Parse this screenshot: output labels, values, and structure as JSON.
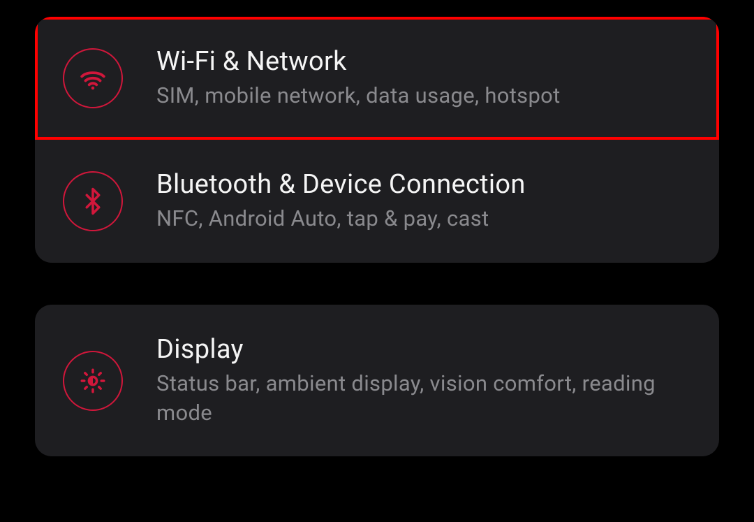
{
  "colors": {
    "accent": "#d1173b",
    "highlight": "#ff0000",
    "card_bg": "#1e1e21",
    "text_primary": "#f5f5f5",
    "text_secondary": "#8a8a8e"
  },
  "settings": {
    "group1": {
      "items": [
        {
          "icon": "wifi-icon",
          "title": "Wi-Fi & Network",
          "subtitle": "SIM, mobile network, data usage, hotspot",
          "highlighted": true
        },
        {
          "icon": "bluetooth-icon",
          "title": "Bluetooth & Device Connection",
          "subtitle": "NFC, Android Auto, tap & pay, cast",
          "highlighted": false
        }
      ]
    },
    "group2": {
      "items": [
        {
          "icon": "display-icon",
          "title": "Display",
          "subtitle": "Status bar, ambient display, vision comfort, reading mode",
          "highlighted": false
        }
      ]
    }
  }
}
